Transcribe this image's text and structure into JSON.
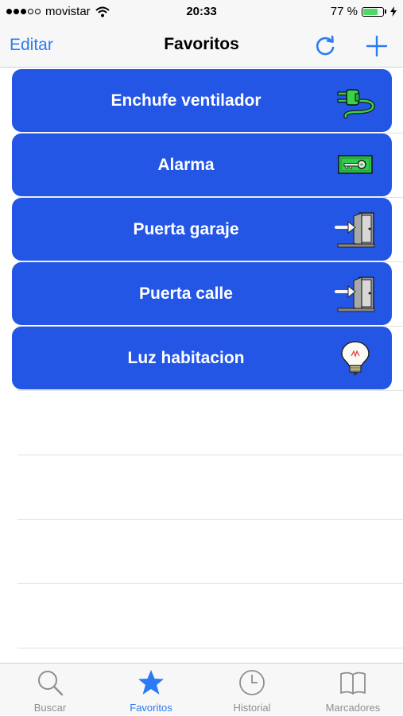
{
  "status_bar": {
    "carrier": "movistar",
    "time": "20:33",
    "battery_text": "77 %",
    "battery_level": 0.77
  },
  "nav": {
    "edit_label": "Editar",
    "title": "Favoritos",
    "refresh_icon": "refresh-icon",
    "add_icon": "add-icon"
  },
  "favorites": [
    {
      "label": "Enchufe ventilador",
      "icon": "plug-icon"
    },
    {
      "label": "Alarma",
      "icon": "key-icon"
    },
    {
      "label": "Puerta garaje",
      "icon": "door-icon"
    },
    {
      "label": "Puerta calle",
      "icon": "door-icon"
    },
    {
      "label": "Luz habitacion",
      "icon": "bulb-icon"
    }
  ],
  "tabs": [
    {
      "label": "Buscar",
      "icon": "search-icon",
      "active": false
    },
    {
      "label": "Favoritos",
      "icon": "star-icon",
      "active": true
    },
    {
      "label": "Historial",
      "icon": "clock-icon",
      "active": false
    },
    {
      "label": "Marcadores",
      "icon": "bookmarks-icon",
      "active": false
    }
  ],
  "colors": {
    "accent": "#2a7bf6",
    "row_background": "#2456e6",
    "battery": "#4cd964"
  }
}
